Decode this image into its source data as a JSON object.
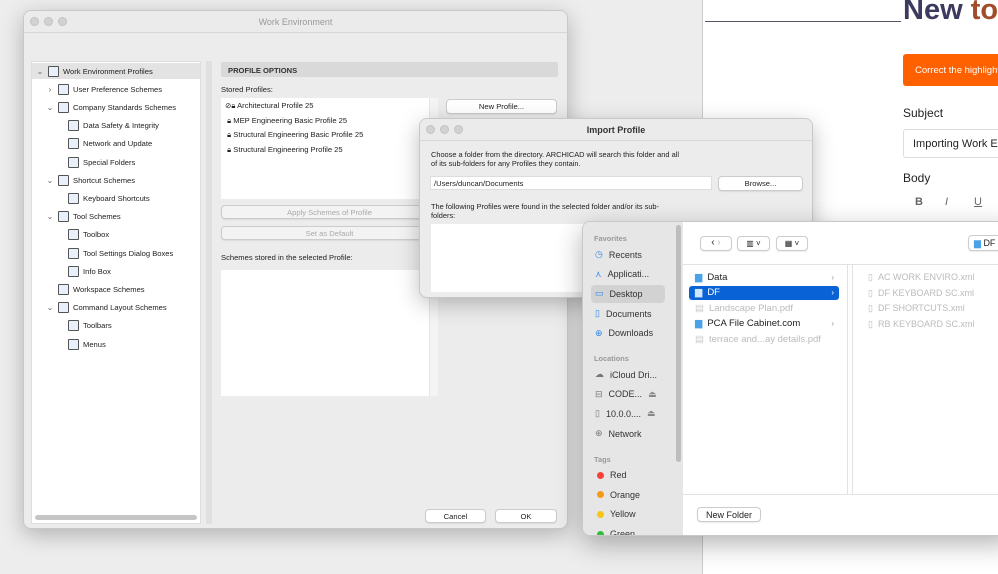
{
  "web": {
    "title_a": "New",
    "title_b": "to",
    "banner": "Correct the highlighted",
    "subject_label": "Subject",
    "subject_value": "Importing Work Environment",
    "body_label": "Body",
    "format": [
      "B",
      "I",
      "U"
    ],
    "colors": {
      "title_a": "#3c3a5f",
      "title_b": "#a24d2a",
      "banner": "#ff6100"
    }
  },
  "we": {
    "title": "Work Environment",
    "tree": [
      {
        "label": "Work Environment Profiles",
        "level": 0,
        "chev": "v"
      },
      {
        "label": "User Preference Schemes",
        "level": 1,
        "chev": ">"
      },
      {
        "label": "Company Standards Schemes",
        "level": 1,
        "chev": "v"
      },
      {
        "label": "Data Safety & Integrity",
        "level": 2
      },
      {
        "label": "Network and Update",
        "level": 2
      },
      {
        "label": "Special Folders",
        "level": 2
      },
      {
        "label": "Shortcut Schemes",
        "level": 1,
        "chev": "v"
      },
      {
        "label": "Keyboard Shortcuts",
        "level": 2
      },
      {
        "label": "Tool Schemes",
        "level": 1,
        "chev": "v"
      },
      {
        "label": "Toolbox",
        "level": 2
      },
      {
        "label": "Tool Settings Dialog Boxes",
        "level": 2
      },
      {
        "label": "Info Box",
        "level": 2
      },
      {
        "label": "Workspace Schemes",
        "level": 1
      },
      {
        "label": "Command Layout Schemes",
        "level": 1,
        "chev": "v"
      },
      {
        "label": "Toolbars",
        "level": 2
      },
      {
        "label": "Menus",
        "level": 2
      }
    ],
    "section": "PROFILE OPTIONS",
    "stored_label": "Stored Profiles:",
    "profiles": [
      "Architectural Profile 25",
      "MEP Engineering Basic Profile 25",
      "Structural Engineering Basic Profile 25",
      "Structural Engineering Profile 25"
    ],
    "new_profile": "New Profile...",
    "apply": "Apply Schemes of Profile",
    "set_default": "Set as Default",
    "schemes_label": "Schemes stored in the selected Profile:",
    "cancel": "Cancel",
    "ok": "OK"
  },
  "imp": {
    "title": "Import Profile",
    "desc1": "Choose a folder from the directory. ARCHICAD will search this folder and all",
    "desc2": "of its sub-folders for any Profiles they contain.",
    "path": "/Users/duncan/Documents",
    "browse": "Browse...",
    "found1": "The following Profiles were found in the selected folder and/or its sub-",
    "found2": "folders:"
  },
  "finder": {
    "favorites": "Favorites",
    "fav": [
      "Recents",
      "Applicati...",
      "Desktop",
      "Documents",
      "Downloads"
    ],
    "locations": "Locations",
    "loc": [
      "iCloud Dri...",
      "CODE...",
      "10.0.0....",
      "Network"
    ],
    "tags_label": "Tags",
    "tags": [
      {
        "name": "Red",
        "color": "#f44336"
      },
      {
        "name": "Orange",
        "color": "#f59a16"
      },
      {
        "name": "Yellow",
        "color": "#f5c518"
      },
      {
        "name": "Green",
        "color": "#2fbf3a"
      }
    ],
    "path_button": "DF",
    "col1": [
      {
        "name": "Data",
        "dim": false,
        "folder": true
      },
      {
        "name": "DF",
        "dim": false,
        "folder": true,
        "selected": true
      },
      {
        "name": "Landscape Plan.pdf",
        "dim": true
      },
      {
        "name": "PCA File Cabinet.com",
        "dim": false,
        "folder": true
      },
      {
        "name": "terrace and...ay details.pdf",
        "dim": true
      }
    ],
    "col2": [
      "AC WORK ENVIRO.xml",
      "DF KEYBOARD SC.xml",
      "DF SHORTCUTS.xml",
      "RB KEYBOARD SC.xml"
    ],
    "new_folder": "New Folder"
  }
}
